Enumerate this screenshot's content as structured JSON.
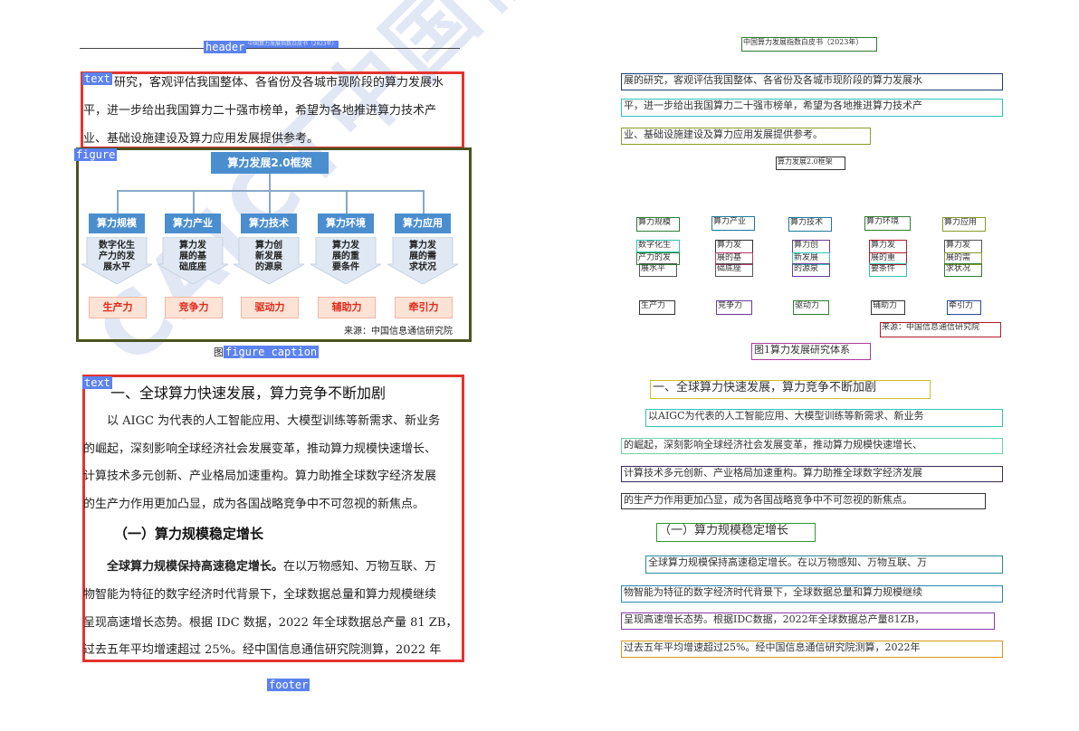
{
  "left_page": {
    "tags": {
      "header": "header",
      "header_inner": "中国算力发展指数白皮书（2023年）",
      "text1": "text",
      "figure": "figure",
      "figure_caption": "figure caption",
      "text2": "text",
      "footer": "footer"
    },
    "intro_lines": [
      "研究，客观评估我国整体、各省份及各城市现阶段的算力发展水",
      "平，进一步给出我国算力二十强市榜单，希望为各地推进算力技术产",
      "业、基础设施建设及算力应用发展提供参考。"
    ],
    "diagram": {
      "top": "算力发展2.0框架",
      "categories": [
        "算力规模",
        "算力产业",
        "算力技术",
        "算力环境",
        "算力应用"
      ],
      "descriptions": [
        [
          "数字化生",
          "产力的发",
          "展水平"
        ],
        [
          "算力发",
          "展的基",
          "础底座"
        ],
        [
          "算力创",
          "新发展",
          "的源泉"
        ],
        [
          "算力发",
          "展的重",
          "要条件"
        ],
        [
          "算力发",
          "展的需",
          "求状况"
        ]
      ],
      "results": [
        "生产力",
        "竞争力",
        "驱动力",
        "辅助力",
        "牵引力"
      ],
      "source": "来源：中国信息通信研究院"
    },
    "caption_prefix": "图",
    "section_title": "一、全球算力快速发展，算力竞争不断加剧",
    "para1_lines": [
      "以 AIGC 为代表的人工智能应用、大模型训练等新需求、新业务",
      "的崛起，深刻影响全球经济社会发展变革，推动算力规模快速增长、",
      "计算技术多元创新、产业格局加速重构。算力助推全球数字经济发展",
      "的生产力作用更加凸显，成为各国战略竞争中不可忽视的新焦点。"
    ],
    "subsection_title": "（一）算力规模稳定增长",
    "para2_bold": "全球算力规模保持高速稳定增长。",
    "para2_first_rest": "在以万物感知、万物互联、万",
    "para2_lines": [
      "物智能为特征的数字经济时代背景下，全球数据总量和算力规模继续",
      "呈现高速增长态势。根据 IDC 数据，2022 年全球数据总产量 81 ZB，",
      "过去五年平均增速超过 25%。经中国信息通信研究院测算，2022 年"
    ],
    "watermark": "CAICT中国信通院"
  },
  "right_page": {
    "header": "中国算力发展指数白皮书（2023年）",
    "intro_lines": [
      "展的研究，客观评估我国整体、各省份及各城市现阶段的算力发展水",
      "平，进一步给出我国算力二十强市榜单，希望为各地推进算力技术产",
      "业、基础设施建设及算力应用发展提供参考。"
    ],
    "diagram_title": "算力发展2.0框架",
    "categories": [
      "算力规模",
      "算力产业",
      "算力技术",
      "算力环境",
      "算力应用"
    ],
    "descriptions": [
      [
        "数字化生",
        "产力的发",
        "展水平"
      ],
      [
        "算力发",
        "展的基",
        "础底座"
      ],
      [
        "算力创",
        "新发展",
        "的源泉"
      ],
      [
        "算力发",
        "展的重",
        "要条件"
      ],
      [
        "算力发",
        "展的需",
        "求状况"
      ]
    ],
    "results": [
      "生产力",
      "竞争力",
      "驱动力",
      "辅助力",
      "牵引力"
    ],
    "source": "来源：中国信息通信研究院",
    "caption": "图1算力发展研究体系",
    "section_title": "一、全球算力快速发展，算力竞争不断加剧",
    "para1_lines": [
      "以AIGC为代表的人工智能应用、大模型训练等新需求、新业务",
      "的崛起，深刻影响全球经济社会发展变革，推动算力规模快速增长、",
      "计算技术多元创新、产业格局加速重构。算力助推全球数字经济发展",
      "的生产力作用更加凸显，成为各国战略竞争中不可忽视的新焦点。"
    ],
    "subsection_title": "（一）算力规模稳定增长",
    "para2_lines": [
      "全球算力规模保持高速稳定增长。在以万物感知、万物互联、万",
      "物智能为特征的数字经济时代背景下，全球数据总量和算力规模继续",
      "呈现高速增长态势。根据IDC数据，2022年全球数据总产量81ZB，",
      "过去五年平均增速超过25%。经中国信息通信研究院测算，2022年"
    ]
  },
  "colors": {
    "tag_blue": "#5b82f0",
    "box_red": "#e3342f",
    "box_olive": "#4a5322",
    "diagram_blue": "#4b8ed0",
    "result_fill": "#fde2d6",
    "result_text": "#e02a1a"
  }
}
